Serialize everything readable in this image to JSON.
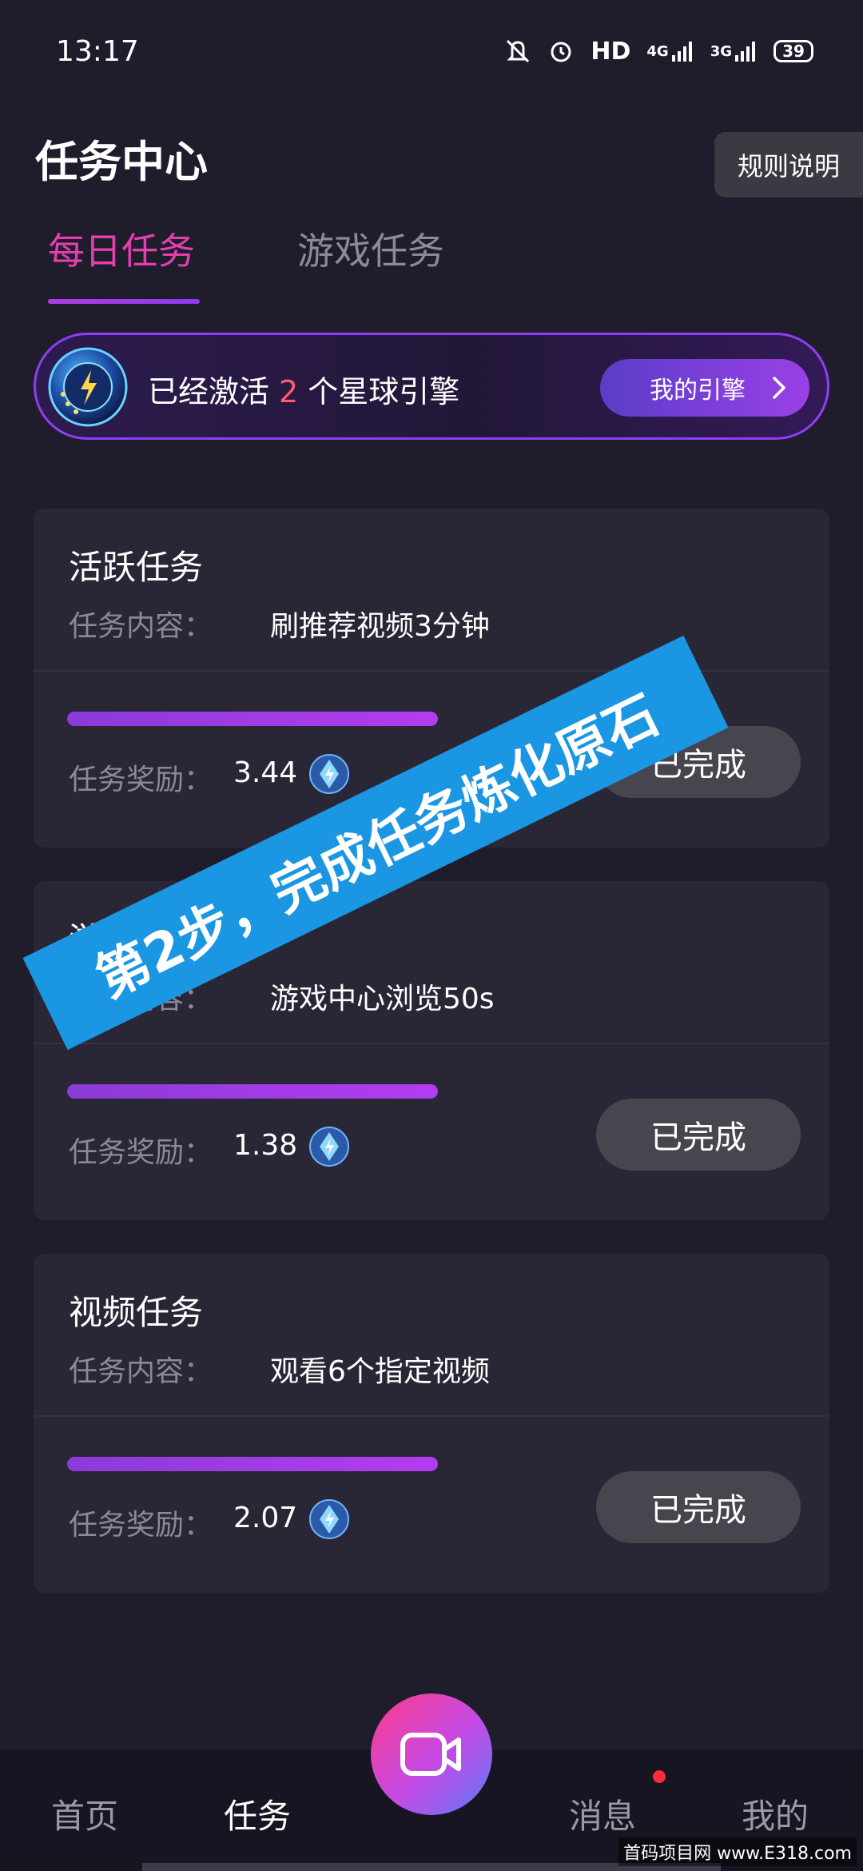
{
  "status_bar": {
    "time": "13:17",
    "hd": "HD",
    "net_4g": "4G",
    "net_3g": "3G",
    "battery": "39"
  },
  "header": {
    "title": "任务中心",
    "rules_label": "规则说明"
  },
  "tabs": [
    {
      "label": "每日任务",
      "active": true
    },
    {
      "label": "游戏任务",
      "active": false
    }
  ],
  "engine": {
    "text_before": "已经激活",
    "count": "2",
    "text_after": "个星球引擎",
    "button_label": "我的引擎"
  },
  "tasks": [
    {
      "title": "活跃任务",
      "content_label": "任务内容：",
      "content": "刷推荐视频3分钟",
      "progress": 1.0,
      "reward_label": "任务奖励：",
      "reward": "3.44",
      "button_label": "已完成"
    },
    {
      "title": "游戏任务",
      "content_label": "任务内容：",
      "content": "游戏中心浏览50s",
      "progress": 1.0,
      "reward_label": "任务奖励：",
      "reward": "1.38",
      "button_label": "已完成"
    },
    {
      "title": "视频任务",
      "content_label": "任务内容：",
      "content": "观看6个指定视频",
      "progress": 1.0,
      "reward_label": "任务奖励：",
      "reward": "2.07",
      "button_label": "已完成"
    }
  ],
  "overlay": {
    "text": "第2步，完成任务炼化原石"
  },
  "bottom_nav": [
    {
      "label": "首页"
    },
    {
      "label": "任务",
      "active": true
    },
    {
      "label": "消息",
      "badge": true
    },
    {
      "label": "我的"
    }
  ],
  "watermark": "首码项目网 www.E318.com",
  "colors": {
    "accent_pink": "#e53fae",
    "accent_purple": "#9a40e6",
    "background": "#1f1d2b",
    "card": "#292736",
    "overlay_blue": "#1b96e3"
  }
}
